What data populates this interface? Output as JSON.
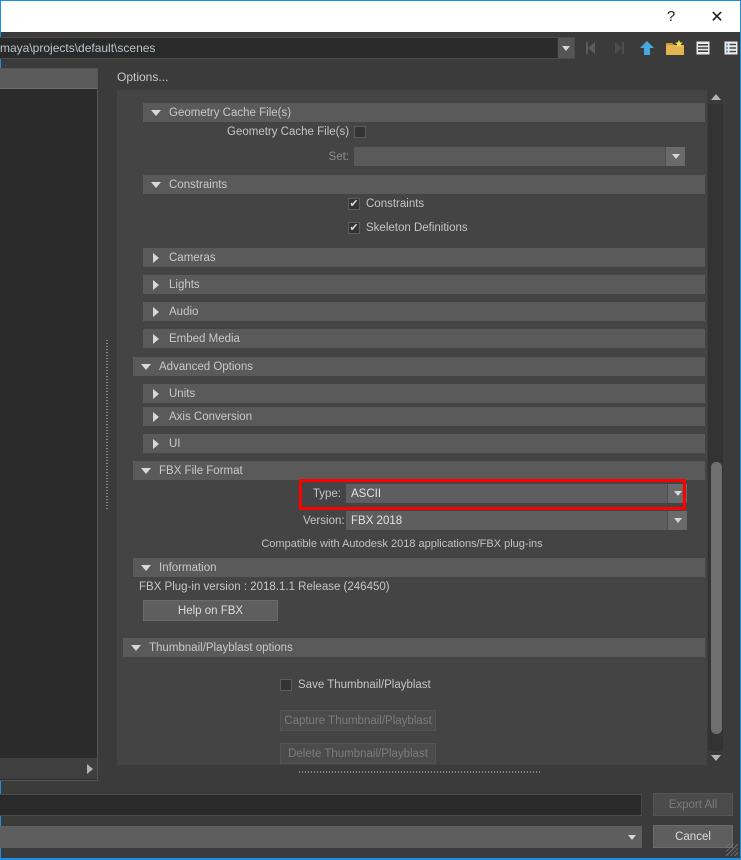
{
  "window": {
    "help_label": "?",
    "close_label": "✕"
  },
  "pathbar": {
    "path": "maya\\projects\\default\\scenes",
    "icons": [
      {
        "name": "back-nav-icon",
        "label": "back"
      },
      {
        "name": "forward-nav-icon",
        "label": "forward"
      },
      {
        "name": "up-folder-icon",
        "label": "up one level"
      },
      {
        "name": "new-folder-icon",
        "label": "new folder"
      },
      {
        "name": "list-view-icon",
        "label": "list view"
      },
      {
        "name": "detail-view-icon",
        "label": "detail view"
      }
    ]
  },
  "options": {
    "title": "Options...",
    "sections": {
      "geometry_cache": "Geometry Cache File(s)",
      "constraints": "Constraints",
      "cameras": "Cameras",
      "lights": "Lights",
      "audio": "Audio",
      "embed_media": "Embed Media",
      "advanced_options": "Advanced Options",
      "units": "Units",
      "axis_conversion": "Axis Conversion",
      "ui": "UI",
      "fbx_file_format": "FBX File Format",
      "information": "Information",
      "thumbnail_playblast": "Thumbnail/Playblast options"
    },
    "geometry_cache": {
      "checkbox_label": "Geometry Cache File(s)",
      "checked": false,
      "set_label": "Set:",
      "set_value": ""
    },
    "constraints": {
      "constraints_label": "Constraints",
      "constraints_checked": true,
      "skeleton_label": "Skeleton Definitions",
      "skeleton_checked": true,
      "check_mark": "✔"
    },
    "fbx_file_format": {
      "type_label": "Type:",
      "type_value": "ASCII",
      "version_label": "Version:",
      "version_value": "FBX 2018",
      "compat_note": "Compatible with Autodesk 2018 applications/FBX plug-ins"
    },
    "information": {
      "plugin_version": "FBX Plug-in version :  2018.1.1 Release (246450)",
      "help_button": "Help on FBX"
    },
    "thumbnail": {
      "save_label": "Save Thumbnail/Playblast",
      "save_checked": false,
      "capture_button": "Capture Thumbnail/Playblast",
      "delete_button": "Delete Thumbnail/Playblast"
    }
  },
  "footer": {
    "file_name_value": "",
    "file_type_value": "",
    "export_all_label": "Export All",
    "cancel_label": "Cancel"
  },
  "colors": {
    "highlight_box": "#fe0000",
    "window_border": "#1d8fe0",
    "panel_bg": "#444444",
    "section_bg": "#5a5a5a"
  }
}
